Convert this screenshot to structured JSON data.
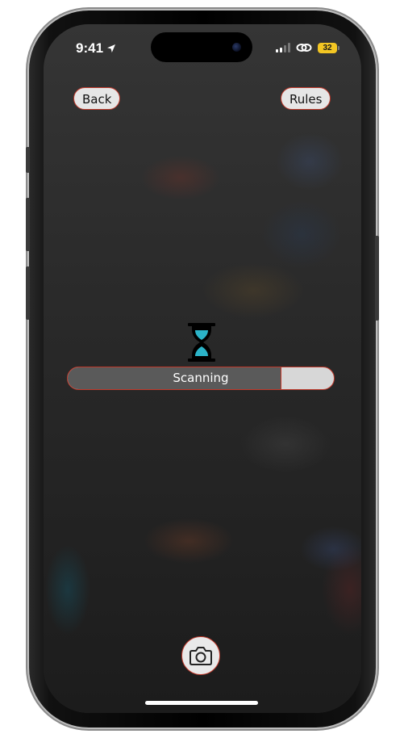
{
  "status_bar": {
    "time": "9:41",
    "battery": "32",
    "icons": [
      "location-arrow-icon",
      "signal-icon",
      "link-icon",
      "battery-icon"
    ]
  },
  "header": {
    "back_label": "Back",
    "rules_label": "Rules"
  },
  "scanner": {
    "icon": "hourglass-icon",
    "status_label": "Scanning",
    "progress": 0.8
  },
  "camera": {
    "icon": "camera-icon"
  },
  "colors": {
    "accent_border": "#c0392b",
    "hourglass_sand": "#2bb3c8",
    "battery": "#f3c623",
    "progress_fill": "#5a5a5a",
    "progress_track": "#d7d7d7"
  }
}
